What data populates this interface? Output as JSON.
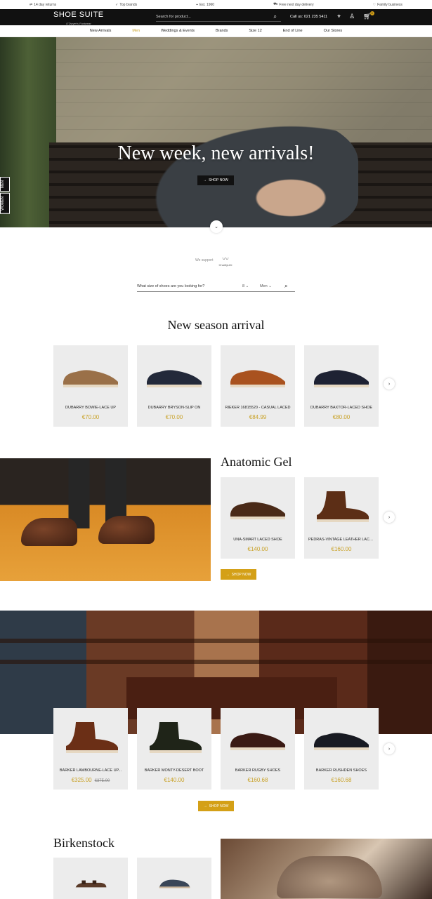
{
  "topbar": {
    "items": [
      {
        "icon": "return-icon",
        "label": "14 day returns"
      },
      {
        "icon": "check-icon",
        "label": "Top brands"
      },
      {
        "icon": "pin-icon",
        "label": "Est. 1960"
      },
      {
        "icon": "truck-icon",
        "label": "Free next day delivery"
      },
      {
        "icon": "heart-icon",
        "label": "Family business"
      }
    ]
  },
  "header": {
    "logo": "SHOE SUITE",
    "tagline": "O'Dwyer's Footwear",
    "search_placeholder": "Search for product...",
    "call_label": "Call us: 021 235 5411",
    "cart_count": "0"
  },
  "nav": {
    "items": [
      "New Arrivals",
      "Men",
      "Weddings & Events",
      "Brands",
      "Size 12",
      "End of Line",
      "Our Stores"
    ],
    "active": "Men"
  },
  "hero": {
    "title": "New week, new arrivals!",
    "button": "SHOP NOW",
    "side_tabs": [
      "MEN",
      "WOMEN"
    ]
  },
  "support": {
    "label": "We support",
    "charity": "CharityLife"
  },
  "size_search": {
    "question": "What size of shoes are you looking for?",
    "size": "8",
    "gender": "Men"
  },
  "new_season": {
    "title": "New season arrival",
    "products": [
      {
        "name": "DUBARRY BOWIE-LACE UP",
        "price": "€70.00",
        "color": "#9a7048"
      },
      {
        "name": "DUBARRY BRYSON-SLIP ON",
        "price": "€70.00",
        "color": "#23293a"
      },
      {
        "name": "RIEKER 16815520 - CASUAL LACED",
        "price": "€84.99",
        "color": "#a9521f"
      },
      {
        "name": "DUBARRY BAXTOR-LACED SHOE",
        "price": "€80.00",
        "color": "#1e2233"
      }
    ]
  },
  "anatomic": {
    "title": "Anatomic Gel",
    "button": "SHOP NOW",
    "products": [
      {
        "name": "UNA-SMART LACED SHOE",
        "price": "€140.00",
        "color": "#4a2a18"
      },
      {
        "name": "PEDRAS-VINTAGE LEATHER LACE...",
        "price": "€160.00",
        "color": "#5c2e16"
      }
    ]
  },
  "barker": {
    "button": "SHOP NOW",
    "products": [
      {
        "name": "BARKER LAMBOURNE-LACE UP...",
        "price": "€325.00",
        "old_price": "€375.00",
        "color": "#6b2f16"
      },
      {
        "name": "BARKER MONTY-DESERT BOOT",
        "price": "€140.00",
        "old_price": "",
        "color": "#1f2418"
      },
      {
        "name": "BARKER RUGBY SHOES",
        "price": "€160.68",
        "old_price": "",
        "color": "#3a1a14"
      },
      {
        "name": "BARKER RUSHDEN SHOES",
        "price": "€160.68",
        "old_price": "",
        "color": "#181a22"
      }
    ]
  },
  "birkenstock": {
    "title": "Birkenstock"
  },
  "colors": {
    "accent": "#c9a227",
    "dark": "#111111",
    "card": "#ececec"
  }
}
